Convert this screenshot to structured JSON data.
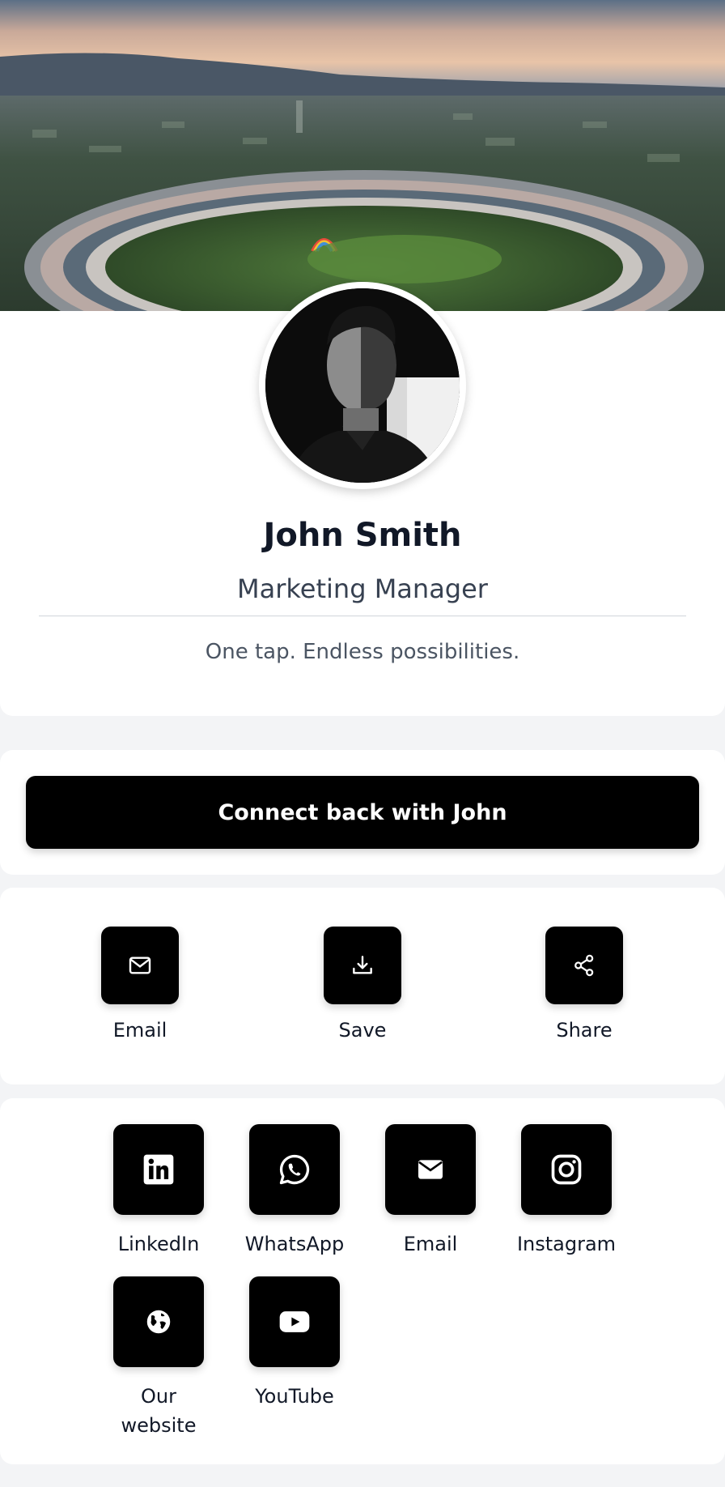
{
  "profile": {
    "name": "John Smith",
    "title": "Marketing Manager",
    "tagline": "One tap. Endless possibilities."
  },
  "connect": {
    "label": "Connect back with John"
  },
  "actions": [
    {
      "label": "Email",
      "icon": "mail-outline-icon"
    },
    {
      "label": "Save",
      "icon": "download-icon"
    },
    {
      "label": "Share",
      "icon": "share-icon"
    }
  ],
  "social": [
    {
      "label": "LinkedIn",
      "icon": "linkedin-icon"
    },
    {
      "label": "WhatsApp",
      "icon": "whatsapp-icon"
    },
    {
      "label": "Email",
      "icon": "mail-filled-icon"
    },
    {
      "label": "Instagram",
      "icon": "instagram-icon"
    },
    {
      "label": "Our website",
      "icon": "globe-icon"
    },
    {
      "label": "YouTube",
      "icon": "youtube-icon"
    }
  ],
  "colors": {
    "primary": "#000000",
    "background": "#f3f4f6",
    "card": "#ffffff",
    "text": "#111827",
    "muted": "#4b5563"
  }
}
